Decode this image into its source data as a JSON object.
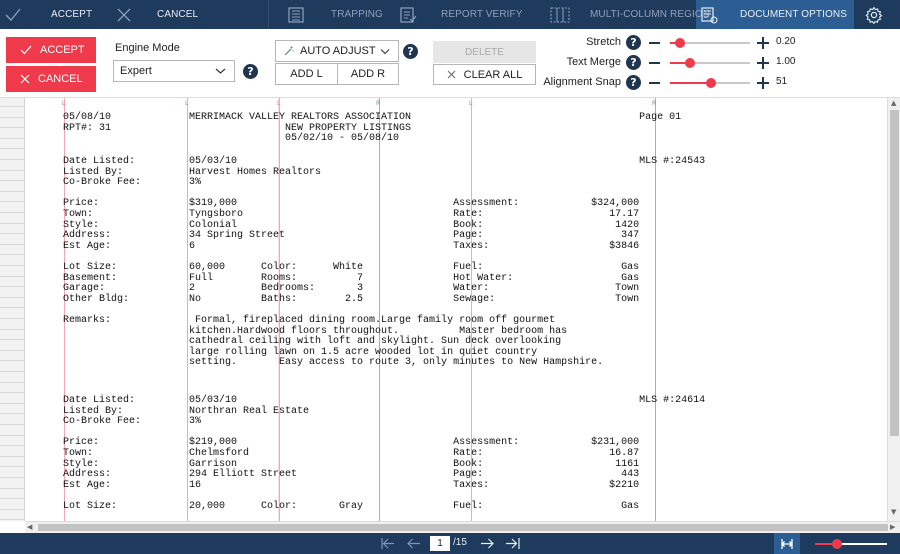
{
  "toolbar": {
    "accept": "ACCEPT",
    "cancel": "CANCEL",
    "trapping": "TRAPPING",
    "report_verify": "REPORT VERIFY",
    "multi_column_region": "MULTI-COLUMN REGION",
    "document_options": "DOCUMENT OPTIONS"
  },
  "panel": {
    "accept": "ACCEPT",
    "cancel": "CANCEL",
    "engine_mode_label": "Engine Mode",
    "engine_mode_value": "Expert",
    "auto_adjust": "AUTO ADJUST",
    "add_l": "ADD L",
    "add_r": "ADD R",
    "delete": "DELETE",
    "clear_all": "CLEAR ALL",
    "help": "?",
    "sliders": [
      {
        "label": "Stretch",
        "value": "0.20",
        "level": 0.13
      },
      {
        "label": "Text Merge",
        "value": "1.00",
        "level": 0.25
      },
      {
        "label": "Alignment Snap",
        "value": "51",
        "level": 0.51
      }
    ]
  },
  "document": {
    "header": [
      "05/08/10             MERRIMACK VALLEY REALTORS ASSOCIATION                                      Page 01",
      "RPT#: 31                             NEW PROPERTY LISTINGS",
      "                                     05/02/10 - 05/08/10"
    ],
    "listing1": [
      "Date Listed:         05/03/10                                                                   MLS #:24543",
      "Listed By:           Harvest Homes Realtors",
      "Co-Broke Fee:        3%",
      "",
      "Price:               $319,000                                    Assessment:            $324,000",
      "Town:                Tyngsboro                                   Rate:                     17.17",
      "Style:               Colonial                                    Book:                      1420",
      "Address:             34 Spring Street                            Page:                       347",
      "Est Age:             6                                           Taxes:                    $3846",
      "",
      "Lot Size:            60,000      Color:      White               Fuel:                       Gas",
      "Basement:            Full        Rooms:          7               Hot Water:                  Gas",
      "Garage:              2           Bedrooms:       3               Water:                     Town",
      "Other Bldg:          No          Baths:        2.5               Sewage:                    Town",
      "",
      "Remarks:              Formal, fireplaced dining room.Large family room off gourmet",
      "                     kitchen.Hardwood floors throughout.          Master bedroom has",
      "                     cathedral ceiling with loft and skylight. Sun deck overlooking",
      "                     large rolling lawn on 1.5 acre wooded lot in quiet country",
      "                     setting.       Easy access to route 3, only minutes to New Hampshire."
    ],
    "listing2": [
      "Date Listed:         05/03/10                                                                   MLS #:24614",
      "Listed By:           Northran Real Estate",
      "Co-Broke Fee:        3%",
      "",
      "Price:               $219,000                                    Assessment:            $231,000",
      "Town:                Chelmsford                                  Rate:                     16.87",
      "Style:               Garrison                                    Book:                      1161",
      "Address:             294 Elliott Street                          Page:                       443",
      "Est Age:             16                                          Taxes:                    $2210",
      "",
      "Lot Size:            20,000      Color:       Gray               Fuel:                       Gas"
    ]
  },
  "pager": {
    "current": "1",
    "total": "/15"
  },
  "zoom": {
    "level": 0.3
  },
  "colors": {
    "navy": "#1e3a5c",
    "active_tab": "#2c5e94",
    "accent_red": "#ee3a4a",
    "column_red": "#f0a9b0",
    "column_blue": "#9bb0c9"
  },
  "icons": {
    "accept": "check-icon",
    "cancel": "x-icon",
    "trapping": "trapping-icon",
    "report_verify": "report-verify-icon",
    "multi_column": "columns-icon",
    "document_options": "document-options-icon",
    "settings": "gear-icon"
  }
}
